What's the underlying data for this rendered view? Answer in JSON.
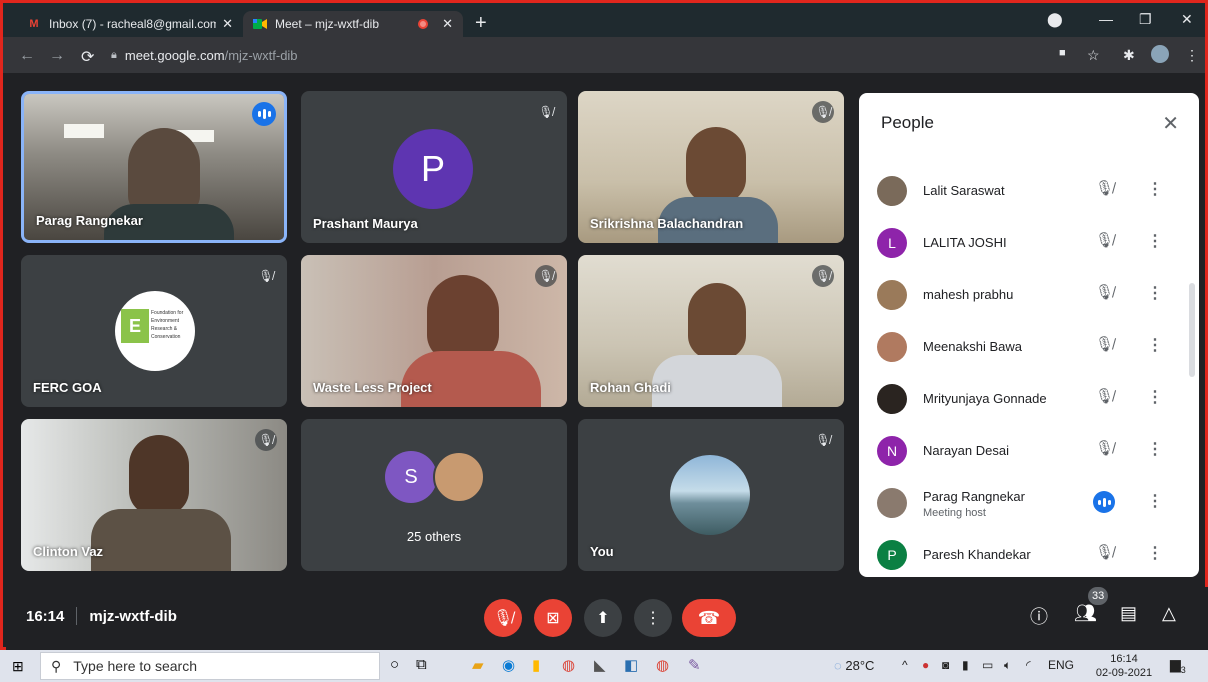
{
  "browser": {
    "tabs": [
      {
        "label": "Inbox (7) - racheal8@gmail.com",
        "icon": "gmail-icon"
      },
      {
        "label": "Meet – mjz-wxtf-dib",
        "icon": "meet-icon"
      }
    ],
    "url_host": "meet.google.com",
    "url_path": "/mjz-wxtf-dib"
  },
  "tiles": [
    {
      "name": "Parag Rangnekar"
    },
    {
      "name": "Prashant Maurya",
      "initial": "P"
    },
    {
      "name": "Srikrishna Balachandran"
    },
    {
      "name": "FERC GOA",
      "logo_letter": "E",
      "logo_lines": [
        "Foundation for",
        "Environment",
        "Research &",
        "Conservation"
      ]
    },
    {
      "name": "Waste Less Project"
    },
    {
      "name": "Rohan Ghadi"
    },
    {
      "name": "Clinton Vaz"
    },
    {
      "name": "25 others",
      "initial": "S"
    },
    {
      "name": "You"
    }
  ],
  "bottom": {
    "time": "16:14",
    "meeting_code": "mjz-wxtf-dib",
    "participant_count": "33"
  },
  "people": {
    "title": "People",
    "list": [
      {
        "name": "Lalit Saraswat"
      },
      {
        "name": "LALITA JOSHI",
        "initial": "L",
        "color": "#8e24aa"
      },
      {
        "name": "mahesh prabhu"
      },
      {
        "name": "Meenakshi Bawa"
      },
      {
        "name": "Mrityunjaya Gonnade"
      },
      {
        "name": "Narayan Desai",
        "initial": "N",
        "color": "#8e24aa"
      },
      {
        "name": "Parag Rangnekar",
        "sub": "Meeting host"
      },
      {
        "name": "Paresh Khandekar",
        "initial": "P",
        "color": "#0b8043"
      }
    ]
  },
  "taskbar": {
    "search_placeholder": "Type here to search",
    "weather": "28°C",
    "lang": "ENG",
    "clock_time": "16:14",
    "clock_date": "02-09-2021",
    "notif_count": "3"
  },
  "colors": {
    "accent": "#1a73e8",
    "danger": "#ea4335",
    "frame": "#e0261d"
  }
}
